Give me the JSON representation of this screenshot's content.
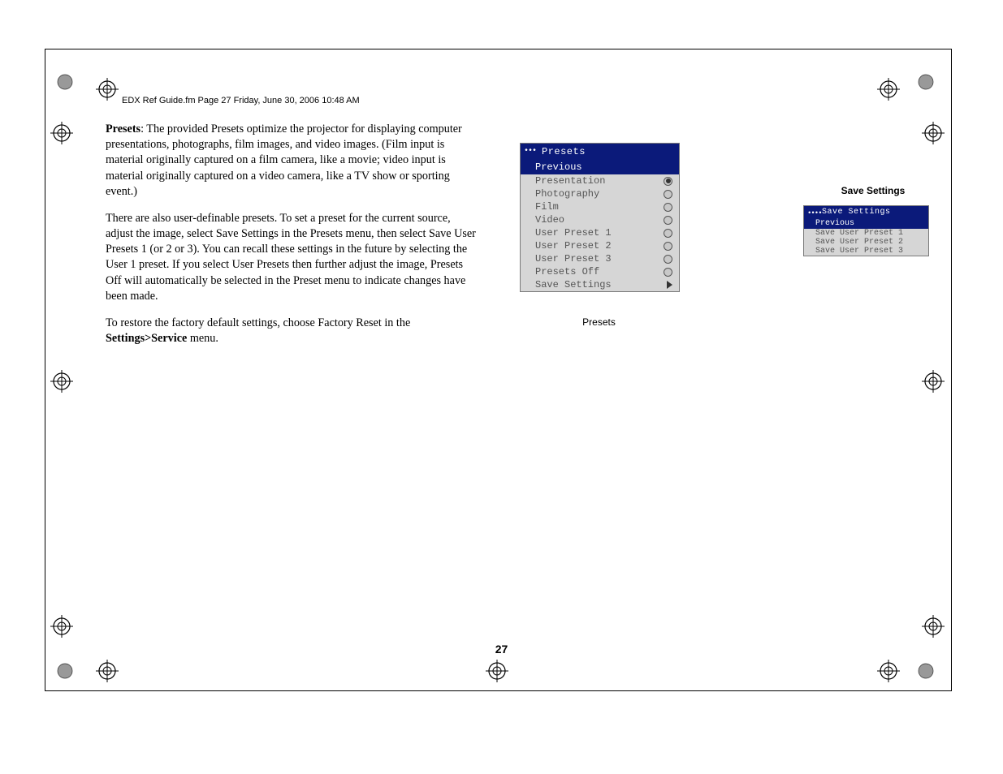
{
  "header": "EDX Ref Guide.fm  Page 27  Friday, June 30, 2006  10:48 AM",
  "body": {
    "p1_bold": "Presets",
    "p1_rest": ": The provided Presets optimize the projector for displaying computer presentations, photographs, film images, and video images. (Film input is material originally captured on a film camera, like a movie; video input is material originally captured on a video camera, like a TV show or sporting event.)",
    "p2": "There are also user-definable presets. To set a preset for the current source, adjust the image, select Save Settings in the Presets menu, then select Save User Presets 1 (or 2 or 3). You can recall these settings in the future by selecting the User 1 preset. If you select User Presets then further adjust the image, Presets Off will automatically be selected in the Preset menu to indicate changes have been made.",
    "p3_a": "To restore the factory default settings, choose Factory Reset in the ",
    "p3_bold": "Settings>Service",
    "p3_b": " menu."
  },
  "page_number": "27",
  "presets": {
    "crumbs": "•••",
    "title": "Presets",
    "highlight": "Previous",
    "items": [
      {
        "label": "Presentation",
        "type": "radio",
        "selected": true
      },
      {
        "label": "Photography",
        "type": "radio",
        "selected": false
      },
      {
        "label": "Film",
        "type": "radio",
        "selected": false
      },
      {
        "label": "Video",
        "type": "radio",
        "selected": false
      },
      {
        "label": "User Preset 1",
        "type": "radio",
        "selected": false
      },
      {
        "label": "User Preset 2",
        "type": "radio",
        "selected": false
      },
      {
        "label": "User Preset 3",
        "type": "radio",
        "selected": false
      },
      {
        "label": "Presets Off",
        "type": "radio",
        "selected": false
      },
      {
        "label": "Save Settings",
        "type": "arrow"
      }
    ],
    "caption": "Presets"
  },
  "save": {
    "caption": "Save Settings",
    "crumbs": "••••",
    "title": "Save Settings",
    "highlight": "Previous",
    "items": [
      {
        "label": "Save User Preset 1"
      },
      {
        "label": "Save User Preset 2"
      },
      {
        "label": "Save User Preset 3"
      }
    ]
  }
}
